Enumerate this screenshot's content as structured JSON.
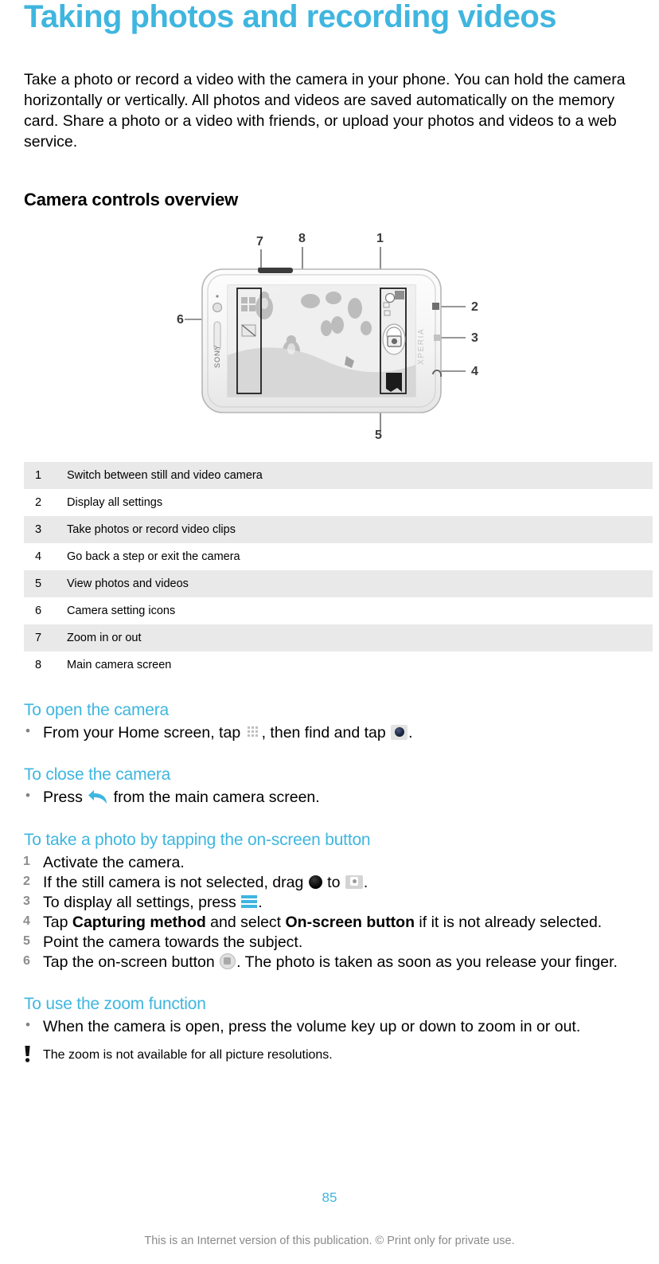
{
  "document": {
    "title": "Taking photos and recording videos",
    "intro": "Take a photo or record a video with the camera in your phone. You can hold the camera horizontally or vertically. All photos and videos are saved automatically on the memory card. Share a photo or a video with friends, or upload your photos and videos to a web service.",
    "accent_color": "#3fb6df",
    "row_shade_color": "#e9e9e9"
  },
  "section": {
    "heading": "Camera controls overview"
  },
  "figure": {
    "alt_name": "sony-xperia-phone-camera-controls-diagram",
    "brand_label": "SONY",
    "side_label": "XPERIA",
    "callout_labels": [
      "1",
      "2",
      "3",
      "4",
      "5",
      "6",
      "7",
      "8"
    ]
  },
  "callout_table": {
    "rows": [
      {
        "num": "1",
        "desc": "Switch between still and video camera"
      },
      {
        "num": "2",
        "desc": "Display all settings"
      },
      {
        "num": "3",
        "desc": "Take photos or record video clips"
      },
      {
        "num": "4",
        "desc": "Go back a step or exit the camera"
      },
      {
        "num": "5",
        "desc": "View photos and videos"
      },
      {
        "num": "6",
        "desc": "Camera setting icons"
      },
      {
        "num": "7",
        "desc": "Zoom in or out"
      },
      {
        "num": "8",
        "desc": "Main camera screen"
      }
    ]
  },
  "open_camera": {
    "heading": "To open the camera",
    "bullet_part1": "From your Home screen, tap ",
    "icon1": "app-grid-icon",
    "bullet_part2": ", then find and tap ",
    "icon2": "camera-lens-icon",
    "bullet_part3": "."
  },
  "close_camera": {
    "heading": "To close the camera",
    "bullet_part1": "Press ",
    "icon1": "back-arrow-icon",
    "bullet_part2": " from the main camera screen."
  },
  "take_photo": {
    "heading": "To take a photo by tapping the on-screen button",
    "steps": [
      {
        "text": "Activate the camera."
      },
      {
        "pre": "If the still camera is not selected, drag ",
        "icon_a": "black-dot-icon",
        "mid": " to ",
        "icon_b": "camera-mode-icon",
        "post": "."
      },
      {
        "pre": "To display all settings, press ",
        "icon_a": "menu-bars-icon",
        "post": "."
      },
      {
        "pre": "Tap ",
        "bold1": "Capturing method",
        "mid": " and select ",
        "bold2": "On-screen button",
        "post": " if it is not already selected."
      },
      {
        "text": "Point the camera towards the subject."
      },
      {
        "pre": "Tap the on-screen button ",
        "icon_a": "shutter-button-icon",
        "post": ". The photo is taken as soon as you release your finger."
      }
    ]
  },
  "zoom_function": {
    "heading": "To use the zoom function",
    "bullet": "When the camera is open, press the volume key up or down to zoom in or out.",
    "note_icon": "exclamation-icon",
    "note": "The zoom is not available for all picture resolutions."
  },
  "footer": {
    "page_number": "85",
    "notice": "This is an Internet version of this publication. © Print only for private use."
  }
}
